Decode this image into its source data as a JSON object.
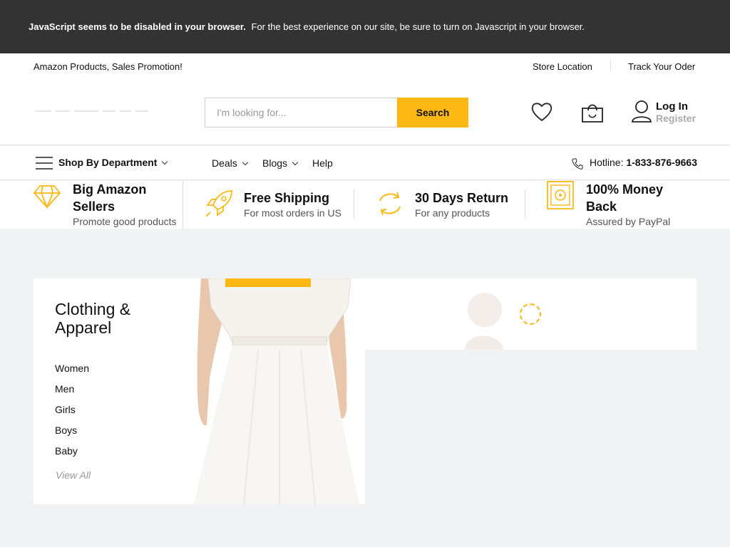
{
  "notice": {
    "bold": "JavaScript seems to be disabled in your browser.",
    "text": "For the best experience on our site, be sure to turn on Javascript in your browser."
  },
  "topbar": {
    "promo": "Amazon Products, Sales Promotion!",
    "store_location": "Store Location",
    "track_order": "Track Your Oder"
  },
  "header": {
    "search_placeholder": "I'm looking for...",
    "search_button": "Search",
    "login": "Log In",
    "register": "Register"
  },
  "nav": {
    "shop_by_department": "Shop By Department",
    "deals": "Deals",
    "blogs": "Blogs",
    "help": "Help",
    "hotline_label": "Hotline:",
    "hotline_number": "1-833-876-9663"
  },
  "features": [
    {
      "title": "Big Amazon Sellers",
      "subtitle": "Promote good products"
    },
    {
      "title": "Free Shipping",
      "subtitle": "For most orders in US"
    },
    {
      "title": "30 Days Return",
      "subtitle": "For any products"
    },
    {
      "title": "100% Money Back",
      "subtitle": "Assured by PayPal"
    }
  ],
  "category_card": {
    "title": "Clothing & Apparel",
    "links": [
      "Women",
      "Men",
      "Girls",
      "Boys",
      "Baby"
    ],
    "view_all": "View All"
  },
  "colors": {
    "accent": "#fdb813",
    "notice_bg": "#333333",
    "page_bg": "#f1f2f3"
  }
}
